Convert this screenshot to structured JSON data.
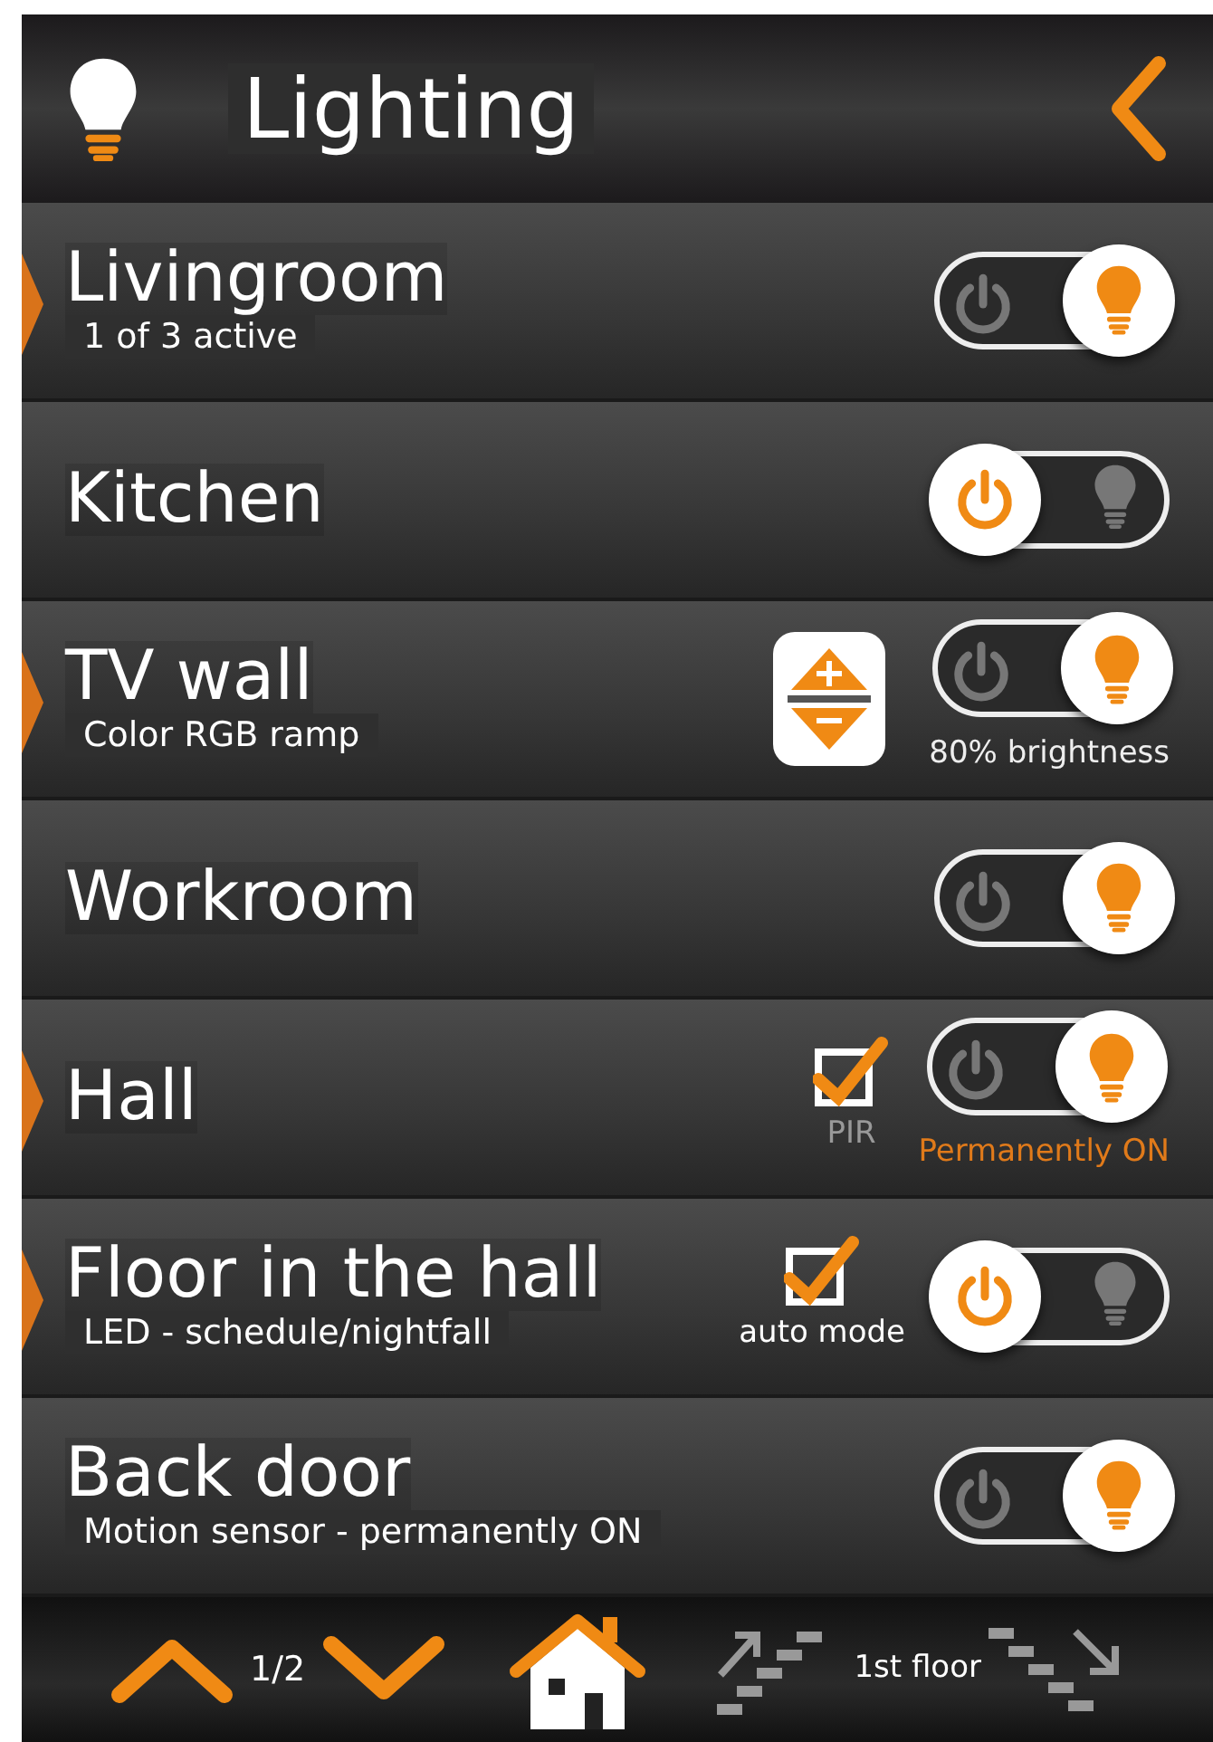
{
  "header": {
    "title": "Lighting"
  },
  "rooms": [
    {
      "name": "Livingroom",
      "subtitle": "1 of 3 active",
      "expandable": true,
      "on": true,
      "kind": "plain"
    },
    {
      "name": "Kitchen",
      "expandable": false,
      "on": false,
      "kind": "plain"
    },
    {
      "name": "TV wall",
      "subtitle": "Color RGB ramp",
      "expandable": true,
      "on": true,
      "kind": "dimmer",
      "status": {
        "text": "80% brightness",
        "highlight": false
      }
    },
    {
      "name": "Workroom",
      "expandable": false,
      "on": true,
      "kind": "plain"
    },
    {
      "name": "Hall",
      "expandable": true,
      "on": true,
      "kind": "checkbox",
      "checkbox": {
        "label": "PIR",
        "checked": true,
        "dim": true
      },
      "status": {
        "text": "Permanently ON",
        "highlight": true
      }
    },
    {
      "name": "Floor in the hall",
      "subtitle": "LED - schedule/nightfall",
      "expandable": true,
      "on": false,
      "kind": "checkbox",
      "checkbox": {
        "label": "auto mode",
        "checked": true,
        "dim": false
      }
    },
    {
      "name": "Back door",
      "subtitle": "Motion sensor - permanently ON",
      "expandable": false,
      "on": true,
      "kind": "plain"
    }
  ],
  "footer": {
    "page": "1/2",
    "floor": "1st floor"
  }
}
